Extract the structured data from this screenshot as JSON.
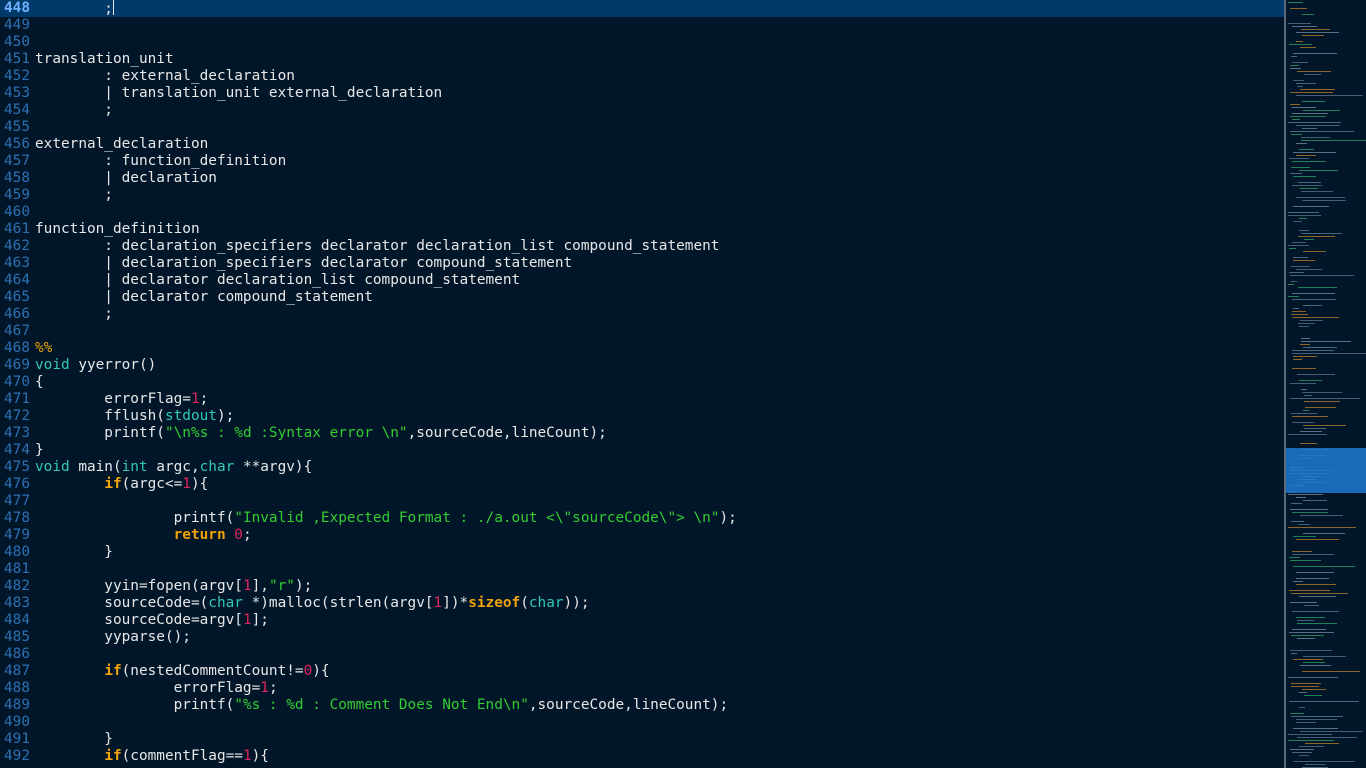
{
  "colors": {
    "background": "#011628",
    "current_line": "#003a6b",
    "line_number": "#2d70b3",
    "line_number_current": "#6fb3ff",
    "text": "#e8e8e8",
    "keyword_type": "#30c9b9",
    "keyword_control": "#f0a30a",
    "string": "#33cc33",
    "number": "#e0245e",
    "directive": "#f0a30a"
  },
  "editor": {
    "current_line_number": "448",
    "lines": [
      {
        "n": "448",
        "current": true,
        "tokens": [
          {
            "t": "        ;",
            "c": "text"
          }
        ],
        "cursor": true
      },
      {
        "n": "449",
        "tokens": []
      },
      {
        "n": "450",
        "tokens": []
      },
      {
        "n": "451",
        "tokens": [
          {
            "t": "translation_unit",
            "c": "text"
          }
        ]
      },
      {
        "n": "452",
        "tokens": [
          {
            "t": "        : external_declaration",
            "c": "text"
          }
        ]
      },
      {
        "n": "453",
        "tokens": [
          {
            "t": "        | translation_unit external_declaration",
            "c": "text"
          }
        ]
      },
      {
        "n": "454",
        "tokens": [
          {
            "t": "        ;",
            "c": "text"
          }
        ]
      },
      {
        "n": "455",
        "tokens": []
      },
      {
        "n": "456",
        "tokens": [
          {
            "t": "external_declaration",
            "c": "text"
          }
        ]
      },
      {
        "n": "457",
        "tokens": [
          {
            "t": "        : function_definition",
            "c": "text"
          }
        ]
      },
      {
        "n": "458",
        "tokens": [
          {
            "t": "        | declaration",
            "c": "text"
          }
        ]
      },
      {
        "n": "459",
        "tokens": [
          {
            "t": "        ;",
            "c": "text"
          }
        ]
      },
      {
        "n": "460",
        "tokens": []
      },
      {
        "n": "461",
        "tokens": [
          {
            "t": "function_definition",
            "c": "text"
          }
        ]
      },
      {
        "n": "462",
        "tokens": [
          {
            "t": "        : declaration_specifiers declarator declaration_list compound_statement",
            "c": "text"
          }
        ]
      },
      {
        "n": "463",
        "tokens": [
          {
            "t": "        | declaration_specifiers declarator compound_statement",
            "c": "text"
          }
        ]
      },
      {
        "n": "464",
        "tokens": [
          {
            "t": "        | declarator declaration_list compound_statement",
            "c": "text"
          }
        ]
      },
      {
        "n": "465",
        "tokens": [
          {
            "t": "        | declarator compound_statement",
            "c": "text"
          }
        ]
      },
      {
        "n": "466",
        "tokens": [
          {
            "t": "        ;",
            "c": "text"
          }
        ]
      },
      {
        "n": "467",
        "tokens": []
      },
      {
        "n": "468",
        "tokens": [
          {
            "t": "%%",
            "c": "directive"
          }
        ]
      },
      {
        "n": "469",
        "tokens": [
          {
            "t": "void",
            "c": "keyword_type"
          },
          {
            "t": " yyerror()",
            "c": "text"
          }
        ]
      },
      {
        "n": "470",
        "tokens": [
          {
            "t": "{",
            "c": "text"
          }
        ]
      },
      {
        "n": "471",
        "tokens": [
          {
            "t": "        errorFlag=",
            "c": "text"
          },
          {
            "t": "1",
            "c": "number"
          },
          {
            "t": ";",
            "c": "text"
          }
        ]
      },
      {
        "n": "472",
        "tokens": [
          {
            "t": "        fflush(",
            "c": "text"
          },
          {
            "t": "stdout",
            "c": "keyword_type"
          },
          {
            "t": ");",
            "c": "text"
          }
        ]
      },
      {
        "n": "473",
        "tokens": [
          {
            "t": "        printf(",
            "c": "text"
          },
          {
            "t": "\"\\n%s : %d :Syntax error \\n\"",
            "c": "string"
          },
          {
            "t": ",sourceCode,lineCount);",
            "c": "text"
          }
        ]
      },
      {
        "n": "474",
        "tokens": [
          {
            "t": "}",
            "c": "text"
          }
        ]
      },
      {
        "n": "475",
        "tokens": [
          {
            "t": "void",
            "c": "keyword_type"
          },
          {
            "t": " main(",
            "c": "text"
          },
          {
            "t": "int",
            "c": "keyword_type"
          },
          {
            "t": " argc,",
            "c": "text"
          },
          {
            "t": "char",
            "c": "keyword_type"
          },
          {
            "t": " **argv){",
            "c": "text"
          }
        ]
      },
      {
        "n": "476",
        "tokens": [
          {
            "t": "        ",
            "c": "text"
          },
          {
            "t": "if",
            "c": "keyword_control"
          },
          {
            "t": "(argc<=",
            "c": "text"
          },
          {
            "t": "1",
            "c": "number"
          },
          {
            "t": "){",
            "c": "text"
          }
        ]
      },
      {
        "n": "477",
        "tokens": []
      },
      {
        "n": "478",
        "tokens": [
          {
            "t": "                printf(",
            "c": "text"
          },
          {
            "t": "\"Invalid ,Expected Format : ./a.out <\\\"sourceCode\\\"> \\n\"",
            "c": "string"
          },
          {
            "t": ");",
            "c": "text"
          }
        ]
      },
      {
        "n": "479",
        "tokens": [
          {
            "t": "                ",
            "c": "text"
          },
          {
            "t": "return",
            "c": "keyword_control"
          },
          {
            "t": " ",
            "c": "text"
          },
          {
            "t": "0",
            "c": "number"
          },
          {
            "t": ";",
            "c": "text"
          }
        ]
      },
      {
        "n": "480",
        "tokens": [
          {
            "t": "        }",
            "c": "text"
          }
        ]
      },
      {
        "n": "481",
        "tokens": []
      },
      {
        "n": "482",
        "tokens": [
          {
            "t": "        yyin=fopen(argv[",
            "c": "text"
          },
          {
            "t": "1",
            "c": "number"
          },
          {
            "t": "],",
            "c": "text"
          },
          {
            "t": "\"r\"",
            "c": "string"
          },
          {
            "t": ");",
            "c": "text"
          }
        ]
      },
      {
        "n": "483",
        "tokens": [
          {
            "t": "        sourceCode=(",
            "c": "text"
          },
          {
            "t": "char",
            "c": "keyword_type"
          },
          {
            "t": " *)malloc(strlen(argv[",
            "c": "text"
          },
          {
            "t": "1",
            "c": "number"
          },
          {
            "t": "])*",
            "c": "text"
          },
          {
            "t": "sizeof",
            "c": "keyword_control"
          },
          {
            "t": "(",
            "c": "text"
          },
          {
            "t": "char",
            "c": "keyword_type"
          },
          {
            "t": "));",
            "c": "text"
          }
        ]
      },
      {
        "n": "484",
        "tokens": [
          {
            "t": "        sourceCode=argv[",
            "c": "text"
          },
          {
            "t": "1",
            "c": "number"
          },
          {
            "t": "];",
            "c": "text"
          }
        ]
      },
      {
        "n": "485",
        "tokens": [
          {
            "t": "        yyparse();",
            "c": "text"
          }
        ]
      },
      {
        "n": "486",
        "tokens": []
      },
      {
        "n": "487",
        "tokens": [
          {
            "t": "        ",
            "c": "text"
          },
          {
            "t": "if",
            "c": "keyword_control"
          },
          {
            "t": "(nestedCommentCount!=",
            "c": "text"
          },
          {
            "t": "0",
            "c": "number"
          },
          {
            "t": "){",
            "c": "text"
          }
        ]
      },
      {
        "n": "488",
        "tokens": [
          {
            "t": "                errorFlag=",
            "c": "text"
          },
          {
            "t": "1",
            "c": "number"
          },
          {
            "t": ";",
            "c": "text"
          }
        ]
      },
      {
        "n": "489",
        "tokens": [
          {
            "t": "                printf(",
            "c": "text"
          },
          {
            "t": "\"%s : %d : Comment Does Not End\\n\"",
            "c": "string"
          },
          {
            "t": ",sourceCode,lineCount);",
            "c": "text"
          }
        ]
      },
      {
        "n": "490",
        "tokens": []
      },
      {
        "n": "491",
        "tokens": [
          {
            "t": "        }",
            "c": "text"
          }
        ]
      },
      {
        "n": "492",
        "tokens": [
          {
            "t": "        ",
            "c": "text"
          },
          {
            "t": "if",
            "c": "keyword_control"
          },
          {
            "t": "(commentFlag==",
            "c": "text"
          },
          {
            "t": "1",
            "c": "number"
          },
          {
            "t": "){",
            "c": "text"
          }
        ]
      }
    ]
  },
  "minimap": {
    "viewport_start_fraction": 0.583,
    "viewport_end_fraction": 0.642
  }
}
